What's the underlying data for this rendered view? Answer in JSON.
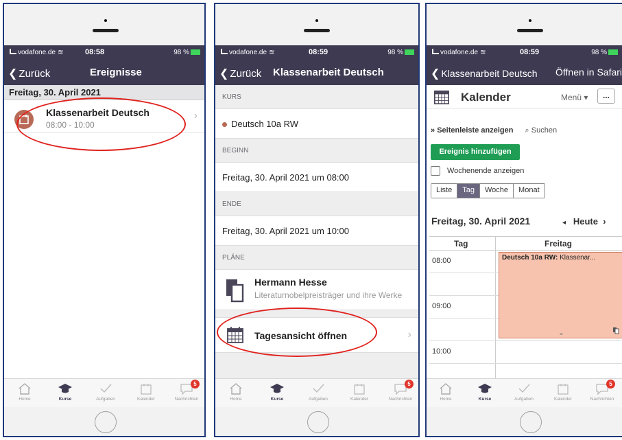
{
  "status": {
    "carrier": "vodafone.de",
    "battery": "98 %",
    "time_screen1": "08:58",
    "time_screen2": "08:59",
    "time_screen3": "08:59"
  },
  "screen1": {
    "back_label": "Zurück",
    "title": "Ereignisse",
    "date_header": "Freitag, 30. April 2021",
    "event": {
      "title": "Klassenarbeit Deutsch",
      "time": "08:00 - 10:00"
    }
  },
  "screen2": {
    "back_label": "Zurück",
    "title": "Klassenarbeit Deutsch",
    "sections": {
      "kurs_label": "KURS",
      "kurs_value": "Deutsch 10a RW",
      "beginn_label": "BEGINN",
      "beginn_value": "Freitag, 30. April 2021 um 08:00",
      "ende_label": "ENDE",
      "ende_value": "Freitag, 30. April 2021 um 10:00",
      "plaene_label": "PLÄNE"
    },
    "plan": {
      "title": "Hermann Hesse",
      "subtitle": "Literaturnobelpreisträger und ihre Werke"
    },
    "open_day_view": "Tagesansicht öffnen"
  },
  "screen3": {
    "back_label": "Klassenarbeit Deutsch",
    "open_in_safari": "Öffnen in Safari",
    "header_title": "Kalender",
    "menu_label": "Menü",
    "more_label": "...",
    "sidebar_link": "Seitenleiste anzeigen",
    "search_link": "Suchen",
    "add_event": "Ereignis hinzufügen",
    "weekend_label": "Wochenende anzeigen",
    "views": [
      "Liste",
      "Tag",
      "Woche",
      "Monat"
    ],
    "active_view": "Tag",
    "day_title": "Freitag, 30. April 2021",
    "today_label": "Heute",
    "col_tag": "Tag",
    "col_day": "Freitag",
    "hours": [
      "08:00",
      "",
      "09:00",
      "",
      "10:00",
      ""
    ],
    "event_course": "Deutsch 10a RW:",
    "event_text": "Klassenar..."
  },
  "tabbar": {
    "items": [
      "Home",
      "Kurse",
      "Aufgaben",
      "Kalender",
      "Nachrichten"
    ],
    "active": "Kurse",
    "badge": "5"
  },
  "colors": {
    "navbar": "#3d3a52",
    "accent_event": "#b86a57",
    "add_button": "#1f9d55",
    "event_block": "#f7c3ae",
    "highlight": "#e0231f"
  }
}
